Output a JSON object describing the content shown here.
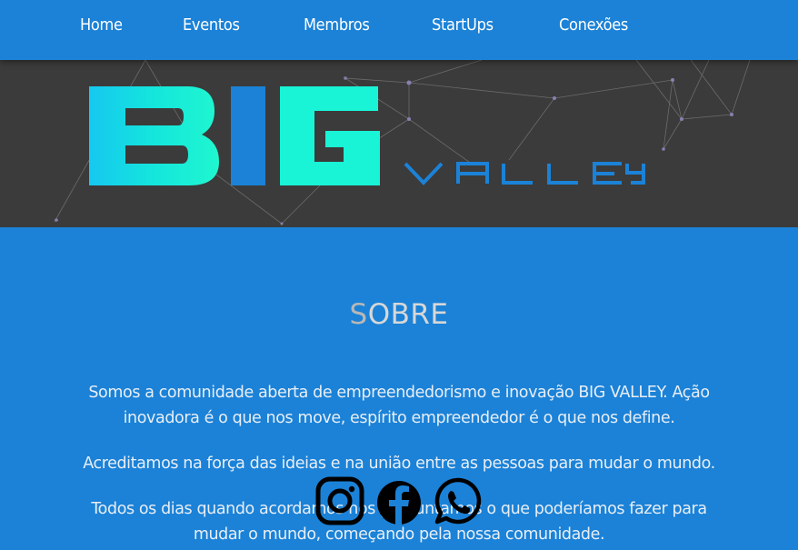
{
  "nav": {
    "items": [
      {
        "label": "Home"
      },
      {
        "label": "Eventos"
      },
      {
        "label": "Membros"
      },
      {
        "label": "StartUps"
      },
      {
        "label": "Conexões"
      }
    ]
  },
  "banner": {
    "logo_big": "BIG",
    "logo_valley": "VALLEY",
    "colors": {
      "background": "#3b3b3b",
      "cyan": "#19f3d6",
      "blue": "#1b82d7"
    }
  },
  "about": {
    "title_first": "S",
    "title_rest": "OBRE",
    "paragraphs": [
      "Somos a comunidade aberta de empreendedorismo e inovação BIG VALLEY. Ação inovadora é o que nos move, espírito empreendedor é o que nos define.",
      "Acreditamos na força das ideias e na união entre as pessoas para mudar o mundo.",
      "Todos os dias quando acordamos nos perguntamos o que poderíamos fazer para mudar o mundo, começando pela nossa comunidade."
    ]
  },
  "social": [
    {
      "icon": "instagram-icon"
    },
    {
      "icon": "facebook-icon"
    },
    {
      "icon": "whatsapp-icon"
    }
  ],
  "colors": {
    "page_background": "#1b82d7",
    "text": "#e8eef6"
  }
}
